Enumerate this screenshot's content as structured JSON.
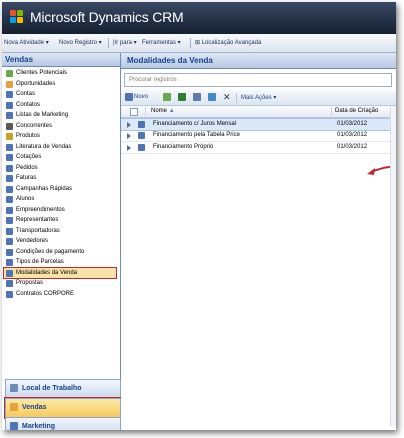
{
  "app": {
    "title": "Microsoft Dynamics CRM"
  },
  "menubar": {
    "items": [
      "Nova Atividade",
      "Novo Registro",
      "Ir para",
      "Ferramentas",
      "Localização Avançada"
    ]
  },
  "nav": {
    "header": "Vendas",
    "items": [
      {
        "label": "Clientes Potenciais",
        "icon": "lead-icon",
        "color": "#6aa84f"
      },
      {
        "label": "Oportunidades",
        "icon": "opportunity-icon",
        "color": "#e6a23c"
      },
      {
        "label": "Contas",
        "icon": "account-icon",
        "color": "#4f74b5"
      },
      {
        "label": "Contatos",
        "icon": "contact-icon",
        "color": "#4f74b5"
      },
      {
        "label": "Listas de Marketing",
        "icon": "list-icon",
        "color": "#4f74b5"
      },
      {
        "label": "Concorrentes",
        "icon": "competitor-icon",
        "color": "#5a5a5a"
      },
      {
        "label": "Produtos",
        "icon": "product-icon",
        "color": "#c9a227"
      },
      {
        "label": "Literatura de Vendas",
        "icon": "literature-icon",
        "color": "#4f74b5"
      },
      {
        "label": "Cotações",
        "icon": "quote-icon",
        "color": "#4f74b5"
      },
      {
        "label": "Pedidos",
        "icon": "order-icon",
        "color": "#4f74b5"
      },
      {
        "label": "Faturas",
        "icon": "invoice-icon",
        "color": "#4f74b5"
      },
      {
        "label": "Campanhas Rápidas",
        "icon": "campaign-icon",
        "color": "#4f74b5"
      },
      {
        "label": "Alunos",
        "icon": "entity-icon",
        "color": "#4f74b5"
      },
      {
        "label": "Empreendimentos",
        "icon": "entity-icon",
        "color": "#4f74b5"
      },
      {
        "label": "Representantes",
        "icon": "entity-icon",
        "color": "#4f74b5"
      },
      {
        "label": "Transportadoras",
        "icon": "entity-icon",
        "color": "#4f74b5"
      },
      {
        "label": "Vendedores",
        "icon": "entity-icon",
        "color": "#4f74b5"
      },
      {
        "label": "Condições de pagamento",
        "icon": "entity-icon",
        "color": "#4f74b5"
      },
      {
        "label": "Tipos de Parcelas",
        "icon": "entity-icon",
        "color": "#4f74b5"
      },
      {
        "label": "Modalidades da Venda",
        "icon": "entity-icon",
        "color": "#4f74b5"
      },
      {
        "label": "Propostas",
        "icon": "entity-icon",
        "color": "#4f74b5"
      },
      {
        "label": "Contratos CORPORE",
        "icon": "entity-icon",
        "color": "#4f74b5"
      }
    ],
    "highlighted_index": 19,
    "areas": [
      {
        "label": "Local de Trabalho",
        "icon": "workplace-icon",
        "active": false
      },
      {
        "label": "Vendas",
        "icon": "sales-icon",
        "active": true
      },
      {
        "label": "Marketing",
        "icon": "marketing-icon",
        "active": false
      }
    ]
  },
  "main": {
    "title": "Modalidades da Venda",
    "search_placeholder": "Procurar registros",
    "toolbar": {
      "new_label": "Novo",
      "more_actions_label": "Mais Ações"
    },
    "grid": {
      "columns": [
        "Nome",
        "Data de Criação"
      ],
      "rows": [
        {
          "name": "Financiamento c/ Juros Mensal",
          "date": "01/03/2012"
        },
        {
          "name": "Financiamento pela Tabela Price",
          "date": "01/03/2012"
        },
        {
          "name": "Financiamento Próprio",
          "date": "01/03/2012"
        }
      ],
      "selected_index": 0
    }
  },
  "colors": {
    "accent": "#15428b",
    "highlight": "#c0282e",
    "annotation_arrow": "#c0282e"
  }
}
